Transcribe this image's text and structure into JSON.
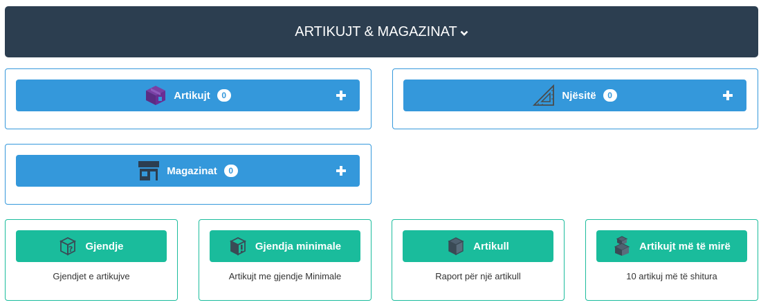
{
  "header": {
    "title": "ARTIKUJT & MAGAZINAT",
    "toggle_icon": "chevron-down-icon"
  },
  "entities": [
    {
      "label": "Artikujt",
      "count": "0",
      "icon": "box-icon"
    },
    {
      "label": "Njësitë",
      "count": "0",
      "icon": "set-square-icon"
    },
    {
      "label": "Magazinat",
      "count": "0",
      "icon": "store-icon"
    }
  ],
  "reports": [
    {
      "label": "Gjendje",
      "description": "Gjendjet e artikujve",
      "icon": "box-question-icon"
    },
    {
      "label": "Gjendja minimale",
      "description": "Artikujt me gjendje Minimale",
      "icon": "box-alert-icon"
    },
    {
      "label": "Artikull",
      "description": "Raport për një artikull",
      "icon": "box-icon"
    },
    {
      "label": "Artikujt më të mirë",
      "description": "10 artikuj më të shitura",
      "icon": "boxes-stacked-icon"
    }
  ],
  "colors": {
    "header": "#2c3e50",
    "primary": "#3498db",
    "success": "#1abc9c"
  }
}
